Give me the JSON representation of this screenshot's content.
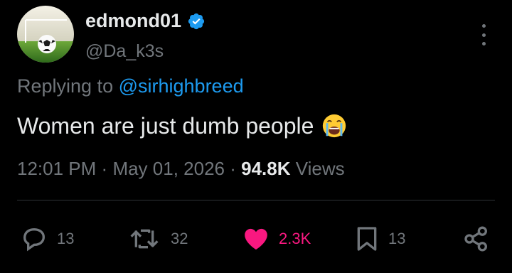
{
  "author": {
    "display_name": "edmond01",
    "handle": "@Da_k3s",
    "verified": true
  },
  "reply": {
    "prefix": "Replying to",
    "mention": "@sirhighbreed"
  },
  "tweet": {
    "text": "Women are just dumb people",
    "emoji": "loudly-crying-face"
  },
  "meta": {
    "time": "12:01 PM",
    "sep1": "·",
    "date": "May 01, 2026",
    "sep2": "·",
    "views_count": "94.8K",
    "views_label": "Views"
  },
  "actions": {
    "replies": "13",
    "reposts": "32",
    "likes": "2.3K",
    "bookmarks": "13"
  },
  "colors": {
    "background": "#000000",
    "text": "#e7e9ea",
    "muted": "#71767b",
    "link": "#1d9bf0",
    "like": "#f91880",
    "verified": "#1d9bf0"
  }
}
